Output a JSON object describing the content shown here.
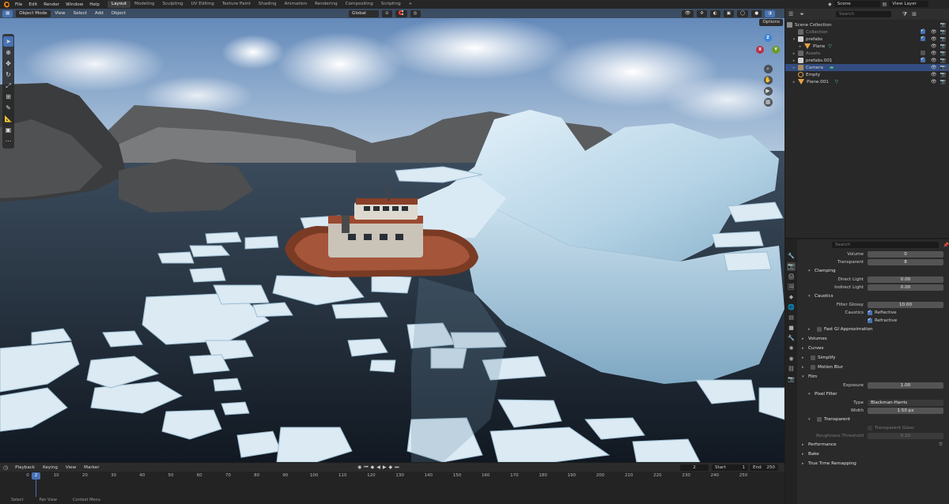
{
  "topbar": {
    "menus": [
      "File",
      "Edit",
      "Render",
      "Window",
      "Help"
    ],
    "workspaces": [
      "Layout",
      "Modeling",
      "Sculpting",
      "UV Editing",
      "Texture Paint",
      "Shading",
      "Animation",
      "Rendering",
      "Compositing",
      "Scripting"
    ],
    "active_workspace": "Layout",
    "scene": "Scene",
    "view_layer": "View Layer"
  },
  "viewport": {
    "mode": "Object Mode",
    "menus": [
      "View",
      "Select",
      "Add",
      "Object"
    ],
    "transform": "Global",
    "options": "Options",
    "gizmo": {
      "x": "X",
      "y": "Y",
      "z": "Z"
    }
  },
  "outliner": {
    "search_placeholder": "Search",
    "root": "Scene Collection",
    "items": [
      {
        "label": "Collection",
        "depth": 1,
        "dim": true
      },
      {
        "label": "prefabs",
        "depth": 1
      },
      {
        "label": "Plane",
        "depth": 2
      },
      {
        "label": "Assets",
        "depth": 1,
        "dim": true
      },
      {
        "label": "prefabs.001",
        "depth": 1
      },
      {
        "label": "Camera",
        "depth": 1,
        "selected": true
      },
      {
        "label": "Empty",
        "depth": 1
      },
      {
        "label": "Plane.001",
        "depth": 1
      }
    ]
  },
  "properties": {
    "search_placeholder": "Search",
    "rows": {
      "volume": {
        "label": "Volume",
        "value": "0"
      },
      "transparent": {
        "label": "Transparent",
        "value": "8"
      },
      "clamping": "Clamping",
      "direct": {
        "label": "Direct Light",
        "value": "0.00"
      },
      "indirect": {
        "label": "Indirect Light",
        "value": "0.00"
      },
      "caustics": "Caustics",
      "filter_glossy": {
        "label": "Filter Glossy",
        "value": "10.00"
      },
      "caustics_label": "Caustics",
      "reflective": "Reflective",
      "refractive": "Refractive",
      "fast_gi": "Fast GI Approximation",
      "volumes": "Volumes",
      "curves": "Curves",
      "simplify": "Simplify",
      "motion_blur": "Motion Blur",
      "film": "Film",
      "exposure": {
        "label": "Exposure",
        "value": "1.00"
      },
      "pixel_filter": "Pixel Filter",
      "type": {
        "label": "Type",
        "value": "Blackman-Harris"
      },
      "width": {
        "label": "Width",
        "value": "1.50 px"
      },
      "transparent_sec": "Transparent",
      "transparent_glass": "Transparent Glass",
      "roughness": {
        "label": "Roughness Threshold",
        "value": "0.10"
      },
      "performance": "Performance",
      "bake": "Bake",
      "true_time": "True Time Remapping"
    }
  },
  "timeline": {
    "menus": [
      "Playback",
      "Keying",
      "View",
      "Marker"
    ],
    "current_frame": "2",
    "start_label": "Start",
    "start": "1",
    "end_label": "End",
    "end": "250",
    "playhead": "2",
    "ticks": [
      "0",
      "10",
      "20",
      "30",
      "40",
      "50",
      "60",
      "70",
      "80",
      "90",
      "100",
      "110",
      "120",
      "130",
      "140",
      "150",
      "160",
      "170",
      "180",
      "190",
      "200",
      "210",
      "220",
      "230",
      "240",
      "250"
    ],
    "status": [
      "Select",
      "Pan View",
      "Context Menu"
    ]
  },
  "colors": {
    "accent": "#4772b3",
    "orange": "#e87d0d",
    "selected_row": "#334d80"
  }
}
